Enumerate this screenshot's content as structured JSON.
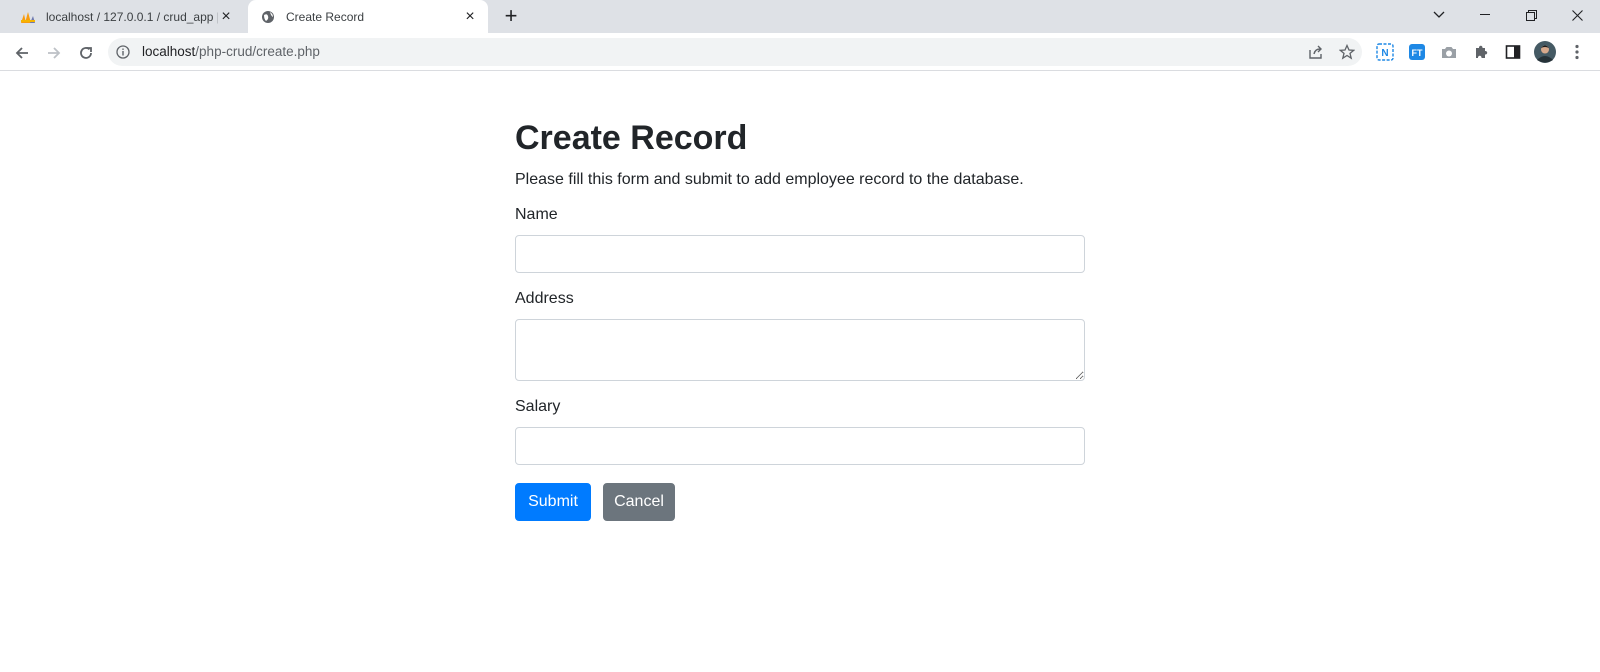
{
  "browser": {
    "tabs": [
      {
        "title": "localhost / 127.0.0.1 / crud_app |",
        "favicon": "phpmyadmin-icon",
        "active": false
      },
      {
        "title": "Create Record",
        "favicon": "globe-icon",
        "active": true
      }
    ],
    "new_tab_label": "+",
    "url_host": "localhost",
    "url_path": "/php-crud/create.php"
  },
  "page": {
    "title": "Create Record",
    "description": "Please fill this form and submit to add employee record to the database.",
    "fields": {
      "name": {
        "label": "Name",
        "value": ""
      },
      "address": {
        "label": "Address",
        "value": ""
      },
      "salary": {
        "label": "Salary",
        "value": ""
      }
    },
    "submit_label": "Submit",
    "cancel_label": "Cancel"
  },
  "colors": {
    "primary": "#007bff",
    "secondary": "#6c757d",
    "tabstrip": "#dee1e6"
  }
}
